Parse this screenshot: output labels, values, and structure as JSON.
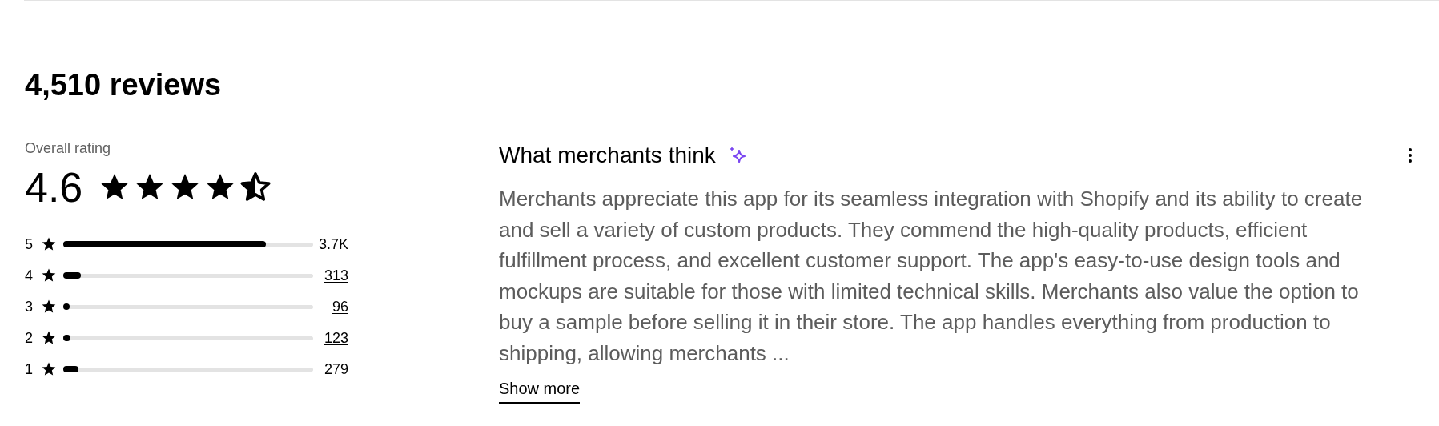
{
  "title": "4,510 reviews",
  "overall": {
    "label": "Overall rating",
    "score": "4.6",
    "stars": 4.5
  },
  "distribution": [
    {
      "rating": "5",
      "level": 0.81,
      "count": "3.7K"
    },
    {
      "rating": "4",
      "level": 0.07,
      "count": "313"
    },
    {
      "rating": "3",
      "level": 0.02,
      "count": "96"
    },
    {
      "rating": "2",
      "level": 0.03,
      "count": "123"
    },
    {
      "rating": "1",
      "level": 0.06,
      "count": "279"
    }
  ],
  "summary": {
    "heading": "What merchants think",
    "text": "Merchants appreciate this app for its seamless integration with Shopify and its ability to create and sell a variety of custom products. They commend the high-quality products, efficient fulfillment process, and excellent customer support. The app's easy-to-use design tools and mockups are suitable for those with limited technical skills. Merchants also value the option to buy a sample before selling it in their store. The app handles everything from production to shipping, allowing merchants ...",
    "show_more": "Show more"
  }
}
